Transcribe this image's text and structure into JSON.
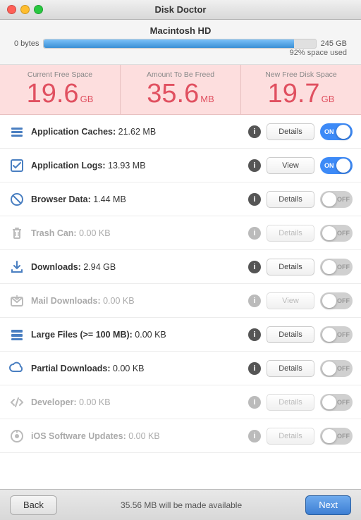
{
  "titleBar": {
    "title": "Disk Doctor"
  },
  "disk": {
    "name": "Macintosh HD",
    "labelLeft": "0 bytes",
    "labelRight": "245 GB",
    "pct": "92% space used",
    "fillPercent": 92
  },
  "stats": [
    {
      "label": "Current Free Space",
      "value": "19.6",
      "unit": "GB"
    },
    {
      "label": "Amount To Be Freed",
      "value": "35.6",
      "unit": "MB"
    },
    {
      "label": "New Free Disk Space",
      "value": "19.7",
      "unit": "GB"
    }
  ],
  "items": [
    {
      "iconType": "layers",
      "active": true,
      "name": "Application Caches:",
      "size": "21.62 MB",
      "btnLabel": "Details",
      "toggleState": "on",
      "dimmed": false
    },
    {
      "iconType": "check",
      "active": true,
      "name": "Application Logs:",
      "size": "13.93 MB",
      "btnLabel": "View",
      "toggleState": "on",
      "dimmed": false
    },
    {
      "iconType": "block",
      "active": true,
      "name": "Browser Data:",
      "size": "1.44 MB",
      "btnLabel": "Details",
      "toggleState": "off",
      "dimmed": false
    },
    {
      "iconType": "trash",
      "active": false,
      "name": "Trash Can:",
      "size": "0.00 KB",
      "btnLabel": "Details",
      "toggleState": "off",
      "dimmed": true
    },
    {
      "iconType": "download",
      "active": true,
      "name": "Downloads:",
      "size": "2.94 GB",
      "btnLabel": "Details",
      "toggleState": "off",
      "dimmed": false
    },
    {
      "iconType": "mail-dl",
      "active": false,
      "name": "Mail Downloads:",
      "size": "0.00 KB",
      "btnLabel": "View",
      "toggleState": "off",
      "dimmed": true
    },
    {
      "iconType": "layers-large",
      "active": true,
      "name": "Large Files (>= 100 MB):",
      "size": "0.00 KB",
      "btnLabel": "Details",
      "toggleState": "off",
      "dimmed": false
    },
    {
      "iconType": "cloud",
      "active": true,
      "name": "Partial Downloads:",
      "size": "0.00 KB",
      "btnLabel": "Details",
      "toggleState": "off",
      "dimmed": false
    },
    {
      "iconType": "code",
      "active": false,
      "name": "Developer:",
      "size": "0.00 KB",
      "btnLabel": "Details",
      "toggleState": "off",
      "dimmed": true
    },
    {
      "iconType": "ios",
      "active": false,
      "name": "iOS Software Updates:",
      "size": "0.00 KB",
      "btnLabel": "Details",
      "toggleState": "off",
      "dimmed": true
    }
  ],
  "bottomBar": {
    "backLabel": "Back",
    "info": "35.56 MB will be made available",
    "nextLabel": "Next"
  }
}
